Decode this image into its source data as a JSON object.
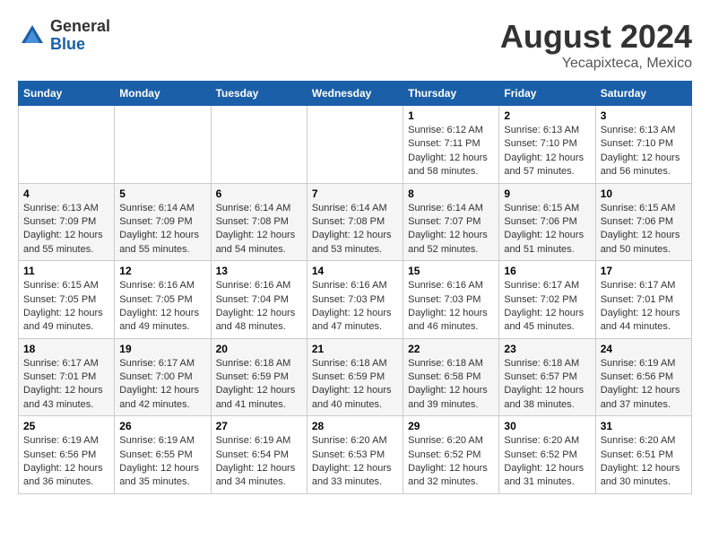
{
  "header": {
    "logo_general": "General",
    "logo_blue": "Blue",
    "month_title": "August 2024",
    "location": "Yecapixteca, Mexico"
  },
  "weekdays": [
    "Sunday",
    "Monday",
    "Tuesday",
    "Wednesday",
    "Thursday",
    "Friday",
    "Saturday"
  ],
  "weeks": [
    [
      {
        "day": "",
        "info": ""
      },
      {
        "day": "",
        "info": ""
      },
      {
        "day": "",
        "info": ""
      },
      {
        "day": "",
        "info": ""
      },
      {
        "day": "1",
        "info": "Sunrise: 6:12 AM\nSunset: 7:11 PM\nDaylight: 12 hours\nand 58 minutes."
      },
      {
        "day": "2",
        "info": "Sunrise: 6:13 AM\nSunset: 7:10 PM\nDaylight: 12 hours\nand 57 minutes."
      },
      {
        "day": "3",
        "info": "Sunrise: 6:13 AM\nSunset: 7:10 PM\nDaylight: 12 hours\nand 56 minutes."
      }
    ],
    [
      {
        "day": "4",
        "info": "Sunrise: 6:13 AM\nSunset: 7:09 PM\nDaylight: 12 hours\nand 55 minutes."
      },
      {
        "day": "5",
        "info": "Sunrise: 6:14 AM\nSunset: 7:09 PM\nDaylight: 12 hours\nand 55 minutes."
      },
      {
        "day": "6",
        "info": "Sunrise: 6:14 AM\nSunset: 7:08 PM\nDaylight: 12 hours\nand 54 minutes."
      },
      {
        "day": "7",
        "info": "Sunrise: 6:14 AM\nSunset: 7:08 PM\nDaylight: 12 hours\nand 53 minutes."
      },
      {
        "day": "8",
        "info": "Sunrise: 6:14 AM\nSunset: 7:07 PM\nDaylight: 12 hours\nand 52 minutes."
      },
      {
        "day": "9",
        "info": "Sunrise: 6:15 AM\nSunset: 7:06 PM\nDaylight: 12 hours\nand 51 minutes."
      },
      {
        "day": "10",
        "info": "Sunrise: 6:15 AM\nSunset: 7:06 PM\nDaylight: 12 hours\nand 50 minutes."
      }
    ],
    [
      {
        "day": "11",
        "info": "Sunrise: 6:15 AM\nSunset: 7:05 PM\nDaylight: 12 hours\nand 49 minutes."
      },
      {
        "day": "12",
        "info": "Sunrise: 6:16 AM\nSunset: 7:05 PM\nDaylight: 12 hours\nand 49 minutes."
      },
      {
        "day": "13",
        "info": "Sunrise: 6:16 AM\nSunset: 7:04 PM\nDaylight: 12 hours\nand 48 minutes."
      },
      {
        "day": "14",
        "info": "Sunrise: 6:16 AM\nSunset: 7:03 PM\nDaylight: 12 hours\nand 47 minutes."
      },
      {
        "day": "15",
        "info": "Sunrise: 6:16 AM\nSunset: 7:03 PM\nDaylight: 12 hours\nand 46 minutes."
      },
      {
        "day": "16",
        "info": "Sunrise: 6:17 AM\nSunset: 7:02 PM\nDaylight: 12 hours\nand 45 minutes."
      },
      {
        "day": "17",
        "info": "Sunrise: 6:17 AM\nSunset: 7:01 PM\nDaylight: 12 hours\nand 44 minutes."
      }
    ],
    [
      {
        "day": "18",
        "info": "Sunrise: 6:17 AM\nSunset: 7:01 PM\nDaylight: 12 hours\nand 43 minutes."
      },
      {
        "day": "19",
        "info": "Sunrise: 6:17 AM\nSunset: 7:00 PM\nDaylight: 12 hours\nand 42 minutes."
      },
      {
        "day": "20",
        "info": "Sunrise: 6:18 AM\nSunset: 6:59 PM\nDaylight: 12 hours\nand 41 minutes."
      },
      {
        "day": "21",
        "info": "Sunrise: 6:18 AM\nSunset: 6:59 PM\nDaylight: 12 hours\nand 40 minutes."
      },
      {
        "day": "22",
        "info": "Sunrise: 6:18 AM\nSunset: 6:58 PM\nDaylight: 12 hours\nand 39 minutes."
      },
      {
        "day": "23",
        "info": "Sunrise: 6:18 AM\nSunset: 6:57 PM\nDaylight: 12 hours\nand 38 minutes."
      },
      {
        "day": "24",
        "info": "Sunrise: 6:19 AM\nSunset: 6:56 PM\nDaylight: 12 hours\nand 37 minutes."
      }
    ],
    [
      {
        "day": "25",
        "info": "Sunrise: 6:19 AM\nSunset: 6:56 PM\nDaylight: 12 hours\nand 36 minutes."
      },
      {
        "day": "26",
        "info": "Sunrise: 6:19 AM\nSunset: 6:55 PM\nDaylight: 12 hours\nand 35 minutes."
      },
      {
        "day": "27",
        "info": "Sunrise: 6:19 AM\nSunset: 6:54 PM\nDaylight: 12 hours\nand 34 minutes."
      },
      {
        "day": "28",
        "info": "Sunrise: 6:20 AM\nSunset: 6:53 PM\nDaylight: 12 hours\nand 33 minutes."
      },
      {
        "day": "29",
        "info": "Sunrise: 6:20 AM\nSunset: 6:52 PM\nDaylight: 12 hours\nand 32 minutes."
      },
      {
        "day": "30",
        "info": "Sunrise: 6:20 AM\nSunset: 6:52 PM\nDaylight: 12 hours\nand 31 minutes."
      },
      {
        "day": "31",
        "info": "Sunrise: 6:20 AM\nSunset: 6:51 PM\nDaylight: 12 hours\nand 30 minutes."
      }
    ]
  ]
}
